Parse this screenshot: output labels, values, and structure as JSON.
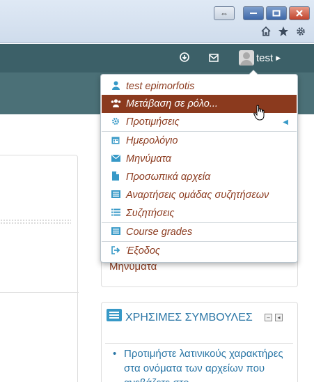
{
  "window": {
    "buttons": [
      "swap-icon",
      "minimize-icon",
      "maximize-icon",
      "close-icon"
    ],
    "toolbar_icons": [
      "home-icon",
      "star-icon",
      "gear-icon"
    ]
  },
  "header": {
    "icons": [
      "notifications-icon",
      "messages-icon"
    ],
    "user_name": "test",
    "colors": {
      "topbar": "#3c6068",
      "subbar": "#4b7077",
      "accent": "#8b3a1e",
      "icon": "#3799c7"
    }
  },
  "user_menu": {
    "items": [
      {
        "icon": "user-icon",
        "label": "test epimorfotis"
      },
      {
        "icon": "users-icon",
        "label": "Μετάβαση σε ρόλο...",
        "active": true
      },
      {
        "icon": "cog-icon",
        "label": "Προτιμήσεις",
        "has_submenu": true
      },
      {
        "icon": "calendar-icon",
        "label": "Ημερολόγιο"
      },
      {
        "icon": "envelope-icon",
        "label": "Μηνύματα"
      },
      {
        "icon": "file-icon",
        "label": "Προσωπικά αρχεία"
      },
      {
        "icon": "list-alt-icon",
        "label": "Αναρτήσεις ομάδας συζητήσεων"
      },
      {
        "icon": "list-icon",
        "label": "Συζητήσεις"
      },
      {
        "icon": "list-alt-icon",
        "label": "Course grades"
      },
      {
        "icon": "sign-out-icon",
        "label": "Έξοδος"
      }
    ]
  },
  "blocks": {
    "messages_link": "Μηνύματα",
    "tips": {
      "title": "ΧΡΗΣΙΜΕΣ ΣΥΜΒΟΥΛΕΣ",
      "items": [
        "Προτιμήστε λατινικούς χαρακτήρες στα ονόματα των αρχείων που ανεβάζετε στο"
      ]
    }
  }
}
